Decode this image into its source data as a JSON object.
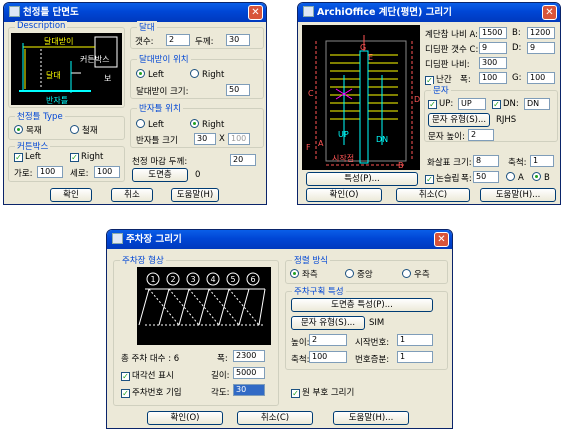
{
  "d1": {
    "title": "천정틀 단면도",
    "desc_label": "Description",
    "preview": {
      "dalde": "달대받이",
      "keoteun": "커튼박스",
      "bo": "보",
      "dalde2": "달대",
      "banja": "반자틀"
    },
    "type_label": "천정틀 Type",
    "type_wood": "목재",
    "type_steel": "철재",
    "ctn_label": "커튼박스",
    "ctn_left": "Left",
    "ctn_right": "Right",
    "ctn_w_label": "가로:",
    "ctn_w": "100",
    "ctn_h_label": "세로:",
    "ctn_h": "100",
    "dalde_label": "달대",
    "gapsu_label": "갯수:",
    "gapsu": "2",
    "dukke_label": "두께:",
    "dukke": "30",
    "ddb_label": "달대받이 위치",
    "ddb_left": "Left",
    "ddb_right": "Right",
    "ddb_size_label": "달대받이 크기:",
    "ddb_size": "50",
    "bjt_label": "반자틀 위치",
    "bjt_left": "Left",
    "bjt_right": "Right",
    "bjt_size_label": "반자틀 크기",
    "bjt_size1": "30",
    "bjt_x": "X",
    "bjt_size2": "100",
    "fin_label": "천정 마감 두께:",
    "fin": "20",
    "layer_btn": "도면층",
    "layer_val": "0",
    "ok": "확인",
    "cancel": "취소",
    "help": "도움말(H)"
  },
  "d2": {
    "title": "ArchiOffice 계단(평면) 그리기",
    "preview": {
      "up": "UP",
      "dn": "DN",
      "start": "시작점",
      "a": "A",
      "b": "B",
      "c": "C",
      "d": "D",
      "e": "E",
      "f": "F",
      "g": "G"
    },
    "wA_label": "계단참 나비 A:",
    "wA": "1500",
    "b_label": "B:",
    "b": "1200",
    "cnt_label": "디딤판 갯수 C:",
    "cnt": "9",
    "d_label": "D:",
    "d": "9",
    "tread_label": "디딤판 나비:",
    "tread": "300",
    "rail_label": "난간",
    "rail_w_label": "폭:",
    "rail_w": "100",
    "g_label": "G:",
    "g": "100",
    "text_label": "문자",
    "up_label": "UP:",
    "up": "UP",
    "dn_label": "DN:",
    "dn": "DN",
    "font_btn": "문자 유형(S)...",
    "font_val": "RJHS",
    "txt_h_label": "문자 높이:",
    "txt_h": "2",
    "arrow_label": "화살표 크기:",
    "arrow": "8",
    "scale_label": "축척:",
    "scale": "1",
    "slope_label": "논슬립",
    "slope_w_label": "폭:",
    "slope_w": "50",
    "opt_a": "A",
    "opt_b": "B",
    "prop_btn": "특성(P)...",
    "ok": "확인(O)",
    "cancel": "취소(C)",
    "help": "도움말(H)..."
  },
  "d3": {
    "title": "주차장 그리기",
    "shape_label": "주차장 형상",
    "nums": [
      "1",
      "2",
      "3",
      "4",
      "5",
      "6"
    ],
    "total_label": "총 주차 대수 :",
    "total": "6",
    "width_label": "폭:",
    "width": "2300",
    "diag_label": "대각선 표시",
    "len_label": "길이:",
    "len": "5000",
    "numtxt_label": "주차번호 기입",
    "angle_label": "각도:",
    "angle": "30",
    "align_label": "정렬 방식",
    "left": "좌측",
    "center": "중앙",
    "right": "우측",
    "props_label": "주차구획 특성",
    "layer_btn": "도면층 특성(P)...",
    "font_btn": "문자 유형(S)...",
    "font_val": "SIM",
    "h_label": "높이:",
    "h": "2",
    "start_label": "시작번호:",
    "start": "1",
    "scale_label": "축척:",
    "scale": "100",
    "inc_label": "번호증분:",
    "inc": "1",
    "circle_label": "원 부호 그리기",
    "ok": "확인(O)",
    "cancel": "취소(C)",
    "help": "도움말(H)..."
  }
}
